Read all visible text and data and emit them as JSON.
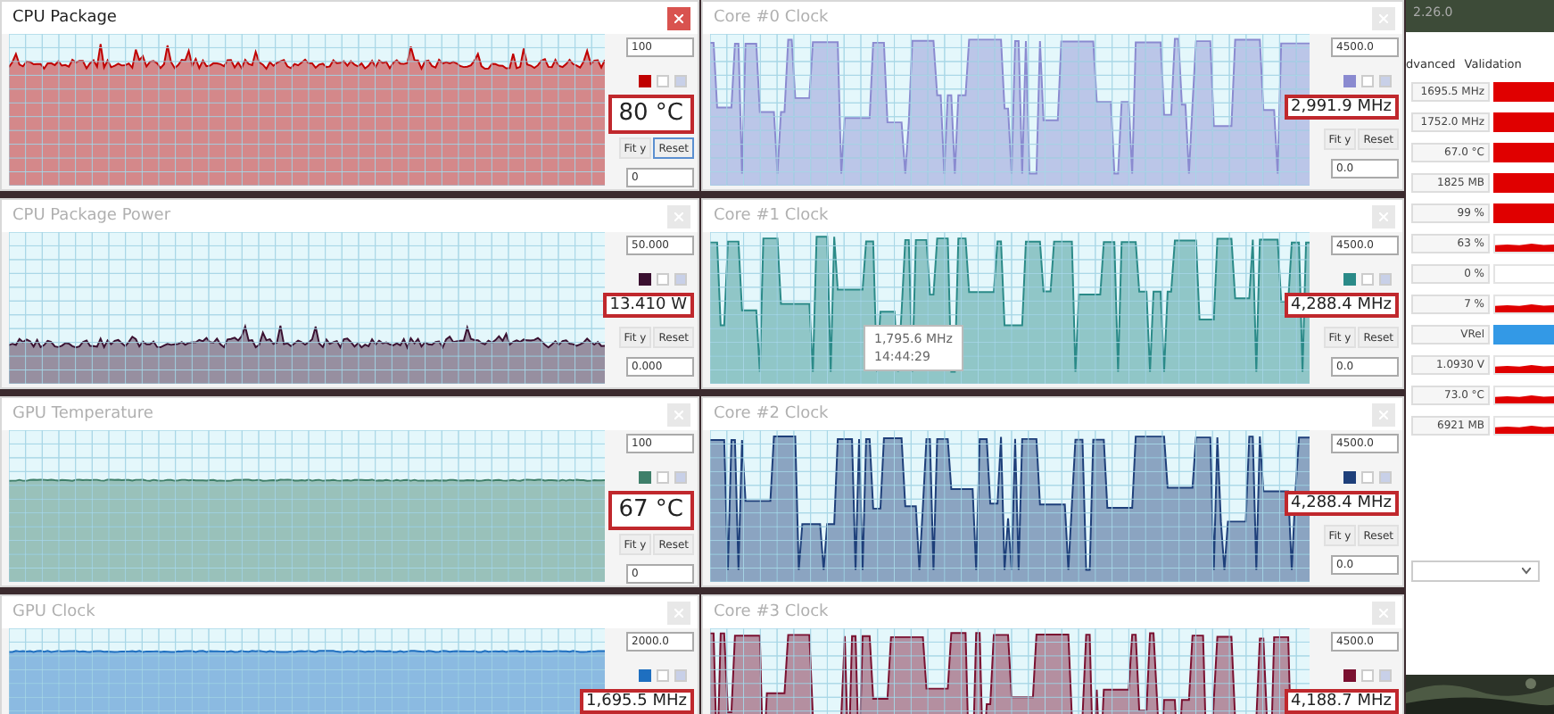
{
  "graph_windows": [
    {
      "title": "CPU Package",
      "active": true,
      "kind": "steady",
      "color": "#c00000",
      "max": "100",
      "min": "0",
      "value": "80 °C",
      "big": true,
      "reset_focused": true,
      "fit_label": "Fit y",
      "reset_label": "Reset"
    },
    {
      "title": "Core #0 Clock",
      "active": false,
      "kind": "pulse",
      "color": "#8a8ad0",
      "max": "4500.0",
      "min": "0.0",
      "value": "2,991.9 MHz",
      "big": false,
      "reset_focused": false,
      "fit_label": "Fit y",
      "reset_label": "Reset"
    },
    {
      "title": "CPU Package Power",
      "active": false,
      "kind": "steady",
      "color": "#3a1030",
      "max": "50.000",
      "min": "0.000",
      "value": "13.410 W",
      "big": false,
      "reset_focused": false,
      "fit_label": "Fit y",
      "reset_label": "Reset"
    },
    {
      "title": "Core #1 Clock",
      "active": false,
      "kind": "pulse",
      "color": "#2a8a88",
      "max": "4500.0",
      "min": "0.0",
      "value": "4,288.4 MHz",
      "big": false,
      "reset_focused": false,
      "fit_label": "Fit y",
      "reset_label": "Reset",
      "tooltip": {
        "value": "1,795.6 MHz",
        "time": "14:44:29"
      }
    },
    {
      "title": "GPU Temperature",
      "active": false,
      "kind": "flat",
      "color": "#3f7f6a",
      "max": "100",
      "min": "0",
      "value": "67 °C",
      "big": true,
      "reset_focused": false,
      "fit_label": "Fit y",
      "reset_label": "Reset"
    },
    {
      "title": "Core #2 Clock",
      "active": false,
      "kind": "pulse",
      "color": "#1e3f7a",
      "max": "4500.0",
      "min": "0.0",
      "value": "4,288.4 MHz",
      "big": false,
      "reset_focused": false,
      "fit_label": "Fit y",
      "reset_label": "Reset"
    },
    {
      "title": "GPU Clock",
      "active": false,
      "kind": "flat",
      "color": "#1e6fc0",
      "max": "2000.0",
      "value": "1,695.5 MHz",
      "big": false
    },
    {
      "title": "Core #3 Clock",
      "active": false,
      "kind": "pulse",
      "color": "#7a1030",
      "max": "4500.0",
      "value": "4,188.7 MHz",
      "big": false
    }
  ],
  "side_panel": {
    "version": "2.26.0",
    "tabs": [
      "dvanced",
      "Validation"
    ],
    "rows": [
      {
        "value": "1695.5 MHz",
        "kind": "block",
        "color": "#e00000"
      },
      {
        "value": "1752.0 MHz",
        "kind": "block",
        "color": "#e00000"
      },
      {
        "value": "67.0 °C",
        "kind": "block",
        "color": "#e00000"
      },
      {
        "value": "1825 MB",
        "kind": "block",
        "color": "#e00000"
      },
      {
        "value": "99 %",
        "kind": "block",
        "color": "#e00000"
      },
      {
        "value": "63 %",
        "kind": "trace",
        "color": "#e00000"
      },
      {
        "value": "0 %",
        "kind": "empty"
      },
      {
        "value": "7 %",
        "kind": "trace",
        "color": "#e00000"
      },
      {
        "value": "VRel",
        "kind": "block",
        "color": "#3399e6"
      },
      {
        "value": "1.0930 V",
        "kind": "trace",
        "color": "#e00000"
      },
      {
        "value": "73.0 °C",
        "kind": "trace",
        "color": "#e00000"
      },
      {
        "value": "6921 MB",
        "kind": "trace",
        "color": "#e00000"
      }
    ]
  }
}
